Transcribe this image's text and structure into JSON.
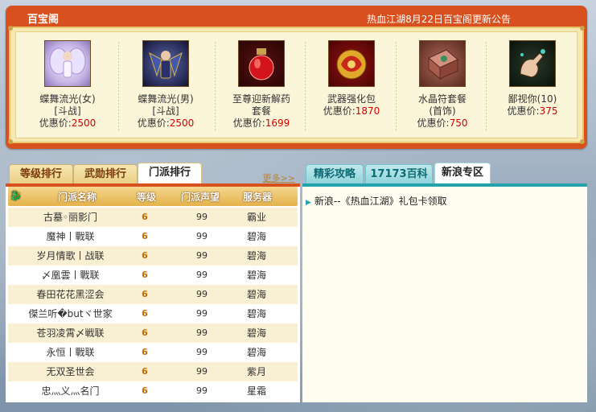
{
  "shop": {
    "title": "百宝阁",
    "notice": "热血江湖8月22日百宝阁更新公告",
    "items": [
      {
        "name": "蝶舞流光(女)",
        "sub": "[斗战]",
        "price_label": "优惠价:",
        "price": "2500",
        "icon": "female-fairy-costume-icon"
      },
      {
        "name": "蝶舞流光(男)",
        "sub": "[斗战]",
        "price_label": "优惠价:",
        "price": "2500",
        "icon": "male-armor-costume-icon"
      },
      {
        "name": "至尊迎新解药",
        "sub": "套餐",
        "price_label": "优惠价:",
        "price": "1699",
        "icon": "red-potion-icon"
      },
      {
        "name": "武器强化包",
        "sub": "",
        "price_label": "优惠价:",
        "price": "1870",
        "icon": "golden-dragon-pouch-icon"
      },
      {
        "name": "水晶符套餐",
        "sub": "(首饰)",
        "price_label": "优惠价:",
        "price": "750",
        "icon": "crystal-talisman-box-icon"
      },
      {
        "name": "鄙视你(10)",
        "sub": "",
        "price_label": "优惠价:",
        "price": "375",
        "icon": "scorn-hand-gesture-icon"
      }
    ]
  },
  "ranking": {
    "tabs": [
      "等级排行",
      "武勋排行",
      "门派排行"
    ],
    "active_tab": 2,
    "more": "更多>>",
    "headers": [
      "门派名称",
      "等级",
      "门派声望",
      "服务器"
    ],
    "rows": [
      {
        "name": "古墓◦丽影门",
        "level": "6",
        "reputation": "99",
        "server": "霸业"
      },
      {
        "name": "魔神丨戰联",
        "level": "6",
        "reputation": "99",
        "server": "碧海"
      },
      {
        "name": "岁月情歌丨战联",
        "level": "6",
        "reputation": "99",
        "server": "碧海"
      },
      {
        "name": "〆凰雲丨戰联",
        "level": "6",
        "reputation": "99",
        "server": "碧海"
      },
      {
        "name": "春田花花黑涩会",
        "level": "6",
        "reputation": "99",
        "server": "碧海"
      },
      {
        "name": "傑兰听�butヾ世家",
        "level": "6",
        "reputation": "99",
        "server": "碧海"
      },
      {
        "name": "苍羽凌霄〆戦联",
        "level": "6",
        "reputation": "99",
        "server": "碧海"
      },
      {
        "name": "永恒丨戰联",
        "level": "6",
        "reputation": "99",
        "server": "碧海"
      },
      {
        "name": "无双圣世会",
        "level": "6",
        "reputation": "99",
        "server": "紫月"
      },
      {
        "name": "忠灬义灬名门",
        "level": "6",
        "reputation": "99",
        "server": "星霜"
      }
    ]
  },
  "news": {
    "tabs": [
      "精彩攻略",
      "17173百科",
      "新浪专区"
    ],
    "active_tab": 2,
    "items": [
      "新浪--《热血江湖》礼包卡领取"
    ]
  },
  "colors": {
    "brand_orange": "#d8501e",
    "teal": "#24a3ad",
    "price_red": "#d40000"
  }
}
